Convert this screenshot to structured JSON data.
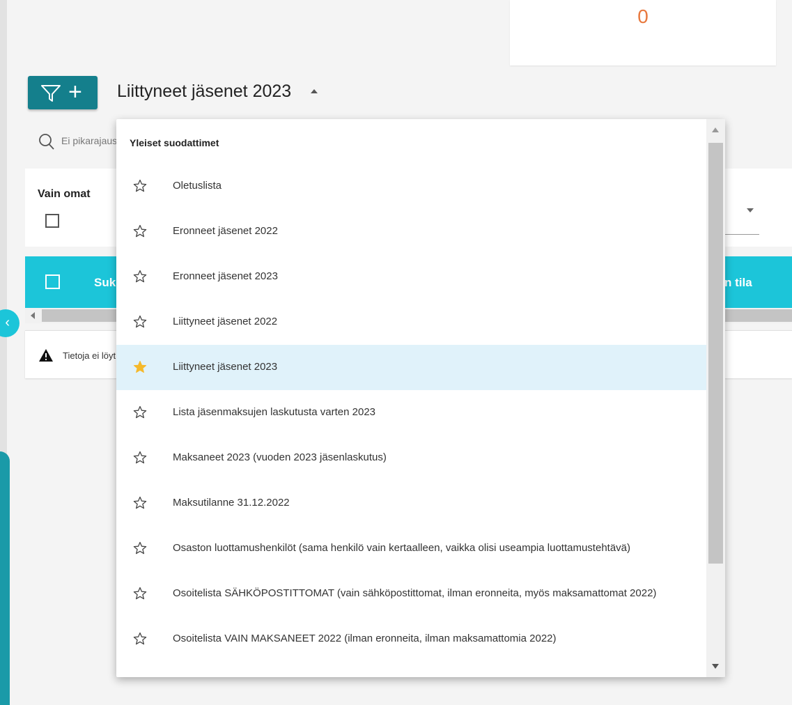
{
  "stat_card": {
    "value": "0"
  },
  "toolbar": {
    "list_title": "Liittyneet jäsenet 2023"
  },
  "search": {
    "placeholder": "Ei pikarajaus"
  },
  "filters": {
    "only_own_label": "Vain omat"
  },
  "table": {
    "col_first": "Sukunimi",
    "col_status": "n tila",
    "no_data": "Tietoja ei löytynyt"
  },
  "dropdown": {
    "heading": "Yleiset suodattimet",
    "items": [
      {
        "label": "Oletuslista",
        "favorite": false
      },
      {
        "label": "Eronneet jäsenet 2022",
        "favorite": false
      },
      {
        "label": "Eronneet jäsenet 2023",
        "favorite": false
      },
      {
        "label": "Liittyneet jäsenet 2022",
        "favorite": false
      },
      {
        "label": "Liittyneet jäsenet 2023",
        "favorite": true
      },
      {
        "label": "Lista jäsenmaksujen laskutusta varten 2023",
        "favorite": false
      },
      {
        "label": "Maksaneet 2023 (vuoden 2023 jäsenlaskutus)",
        "favorite": false
      },
      {
        "label": "Maksutilanne 31.12.2022",
        "favorite": false
      },
      {
        "label": "Osaston luottamushenkilöt (sama henkilö vain kertaalleen, vaikka olisi useampia luottamustehtävä)",
        "favorite": false
      },
      {
        "label": "Osoitelista SÄHKÖPOSTITTOMAT (vain sähköpostittomat, ilman eronneita, myös maksamattomat 2022)",
        "favorite": false
      },
      {
        "label": "Osoitelista VAIN MAKSANEET 2022 (ilman eronneita, ilman maksamattomia 2022)",
        "favorite": false
      }
    ],
    "selected_index": 4
  },
  "colors": {
    "accent": "#147f8c",
    "header": "#1cc5d9",
    "counter": "#e8793f",
    "favorite_star": "#f5b92b",
    "selected_row": "#e0f2fa"
  }
}
